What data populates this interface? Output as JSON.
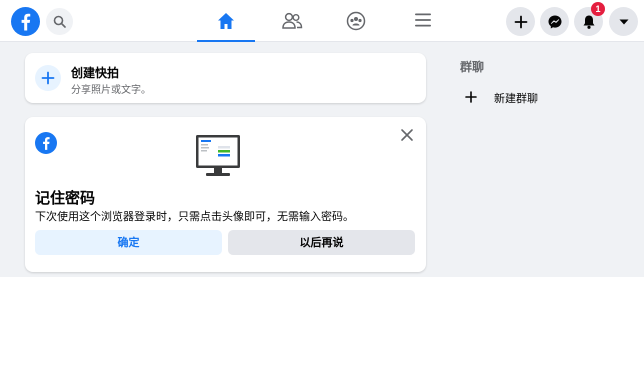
{
  "colors": {
    "brand": "#1877f2",
    "page_background": "#f0f2f5",
    "badge": "#e41e3f"
  },
  "header": {
    "logo_icon": "facebook-logo",
    "search_icon": "search-icon",
    "nav_tabs": [
      {
        "icon": "home-icon",
        "active": true
      },
      {
        "icon": "friends-icon",
        "active": false
      },
      {
        "icon": "groups-icon",
        "active": false
      },
      {
        "icon": "menu-icon",
        "active": false
      }
    ],
    "actions": [
      {
        "icon": "plus-icon"
      },
      {
        "icon": "messenger-icon"
      },
      {
        "icon": "bell-icon",
        "badge": "1"
      },
      {
        "icon": "caret-down-icon"
      }
    ]
  },
  "create_story": {
    "title": "创建快拍",
    "subtitle": "分享照片或文字。"
  },
  "remember_password": {
    "title": "记住密码",
    "description": "下次使用这个浏览器登录时，只需点击头像即可，无需输入密码。",
    "confirm_label": "确定",
    "later_label": "以后再说"
  },
  "sidebar": {
    "section_title": "群聊",
    "new_group_label": "新建群聊"
  }
}
